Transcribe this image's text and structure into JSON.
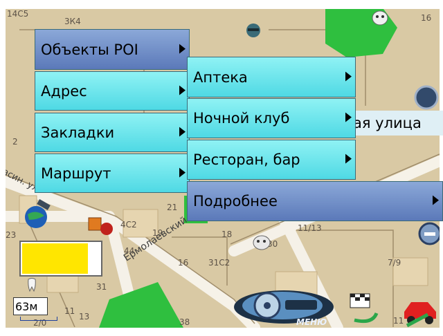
{
  "main_menu": {
    "items": [
      {
        "label": "Объекты POI",
        "has_submenu": true,
        "selected": true
      },
      {
        "label": "Адрес",
        "has_submenu": true,
        "selected": false
      },
      {
        "label": "Закладки",
        "has_submenu": true,
        "selected": false
      },
      {
        "label": "Маршрут",
        "has_submenu": true,
        "selected": false
      }
    ]
  },
  "poi_submenu": {
    "items": [
      {
        "label": "Аптека",
        "has_submenu": true,
        "selected": false
      },
      {
        "label": "Ночной клуб",
        "has_submenu": true,
        "selected": false
      },
      {
        "label": "Ресторан, бар",
        "has_submenu": true,
        "selected": false
      },
      {
        "label": "Подробнее",
        "has_submenu": true,
        "selected": true
      }
    ]
  },
  "map": {
    "street_names": {
      "partial_street": "ая улица",
      "ermolaevsky": "Ермолаевский",
      "left_street": "асин. ул."
    },
    "building_numbers": [
      "14С5",
      "3К4",
      "16",
      "2",
      "23",
      "4С2",
      "19",
      "21",
      "18",
      "44",
      "16",
      "31С2",
      "30",
      "11/13",
      "11",
      "7/9",
      "31",
      "11",
      "13",
      "38",
      "11",
      "2/0"
    ],
    "scale_label": "63м",
    "progress_fraction": 0.85
  },
  "toolbar": {
    "menu_label": "МЕНЮ"
  },
  "colors": {
    "menu_cyan": "#5fe0ea",
    "menu_selected_blue": "#6d8ac6",
    "map_background": "#d9c9a4",
    "park_green": "#2fbf3f",
    "indicator_yellow": "#ffe600"
  }
}
